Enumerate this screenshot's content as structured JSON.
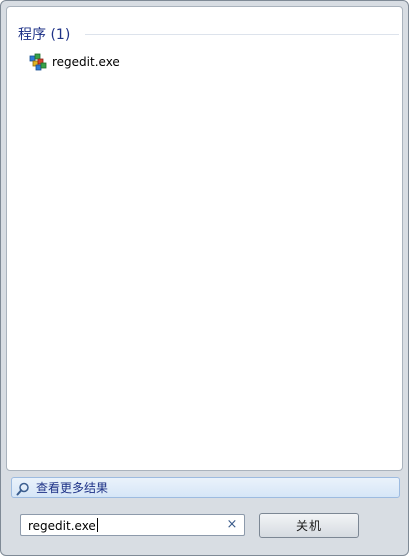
{
  "results": {
    "group_header": "程序 (1)",
    "items": [
      {
        "label": "regedit.exe",
        "icon": "regedit-icon"
      }
    ]
  },
  "see_more": {
    "label": "查看更多结果",
    "icon": "search-icon"
  },
  "search": {
    "value": "regedit.exe",
    "clear_icon": "clear-icon",
    "clear_glyph": "×"
  },
  "shutdown": {
    "label": "关机"
  },
  "colors": {
    "group_header": "#1e3287",
    "see_more_bg": "#dbe8f7",
    "frame_bg": "#d8dde3"
  }
}
